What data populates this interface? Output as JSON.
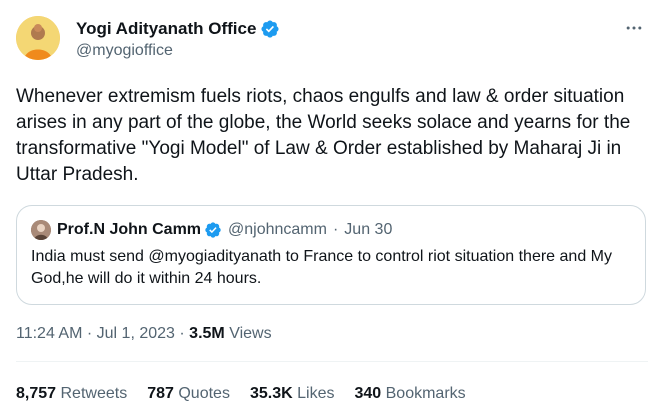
{
  "author": {
    "display_name": "Yogi Adityanath Office",
    "handle": "@myogioffice",
    "verified": true
  },
  "tweet": {
    "text": "Whenever extremism fuels riots, chaos engulfs and law & order situation arises in any part of the globe, the World seeks solace and yearns for the transformative \"Yogi Model\" of Law & Order established by Maharaj Ji in Uttar Pradesh."
  },
  "quote": {
    "display_name": "Prof.N John Camm",
    "handle": "@njohncamm",
    "separator": "·",
    "date": "Jun 30",
    "text": "India must send @myogiadityanath to France to control riot situation there and My God,he will do it within 24 hours."
  },
  "meta": {
    "time": "11:24 AM",
    "separator": "·",
    "date": "Jul 1, 2023",
    "views_count": "3.5M",
    "views_label": "Views"
  },
  "stats": [
    {
      "count": "8,757",
      "label": "Retweets"
    },
    {
      "count": "787",
      "label": "Quotes"
    },
    {
      "count": "35.3K",
      "label": "Likes"
    },
    {
      "count": "340",
      "label": "Bookmarks"
    }
  ],
  "colors": {
    "verified_blue": "#1d9bf0",
    "secondary_text": "#536471",
    "border": "#cfd9de"
  },
  "icons": [
    "more-icon",
    "verified-badge-icon"
  ]
}
